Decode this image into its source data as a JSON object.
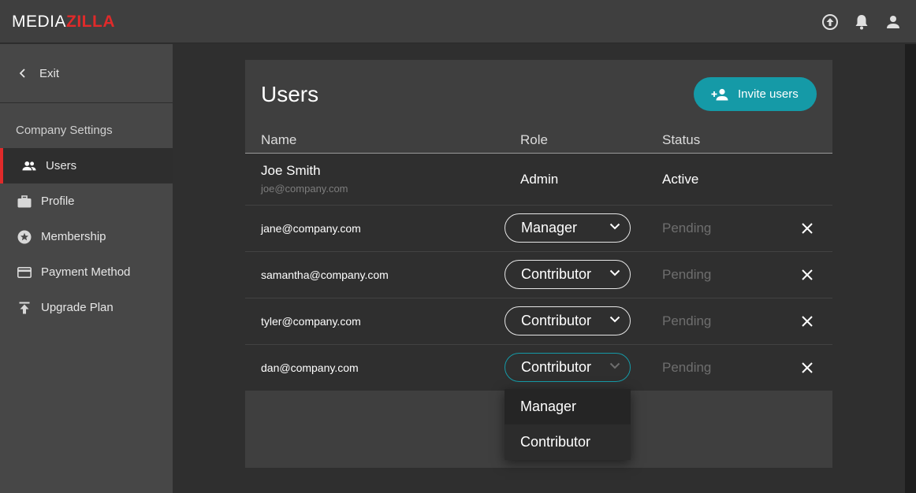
{
  "app": {
    "logo_part1": "MEDIA",
    "logo_part2": "ZILLA",
    "brand_red": "#e02a2a",
    "accent": "#159aa7"
  },
  "topbar": {
    "icons": [
      "upload-icon",
      "bell-icon",
      "account-icon"
    ]
  },
  "sidebar": {
    "exit_label": "Exit",
    "section_title": "Company Settings",
    "items": [
      {
        "label": "Users",
        "icon": "users-icon",
        "active": true
      },
      {
        "label": "Profile",
        "icon": "briefcase-icon"
      },
      {
        "label": "Membership",
        "icon": "star-badge-icon"
      },
      {
        "label": "Payment Method",
        "icon": "credit-card-icon"
      },
      {
        "label": "Upgrade Plan",
        "icon": "upgrade-icon"
      }
    ]
  },
  "users": {
    "title": "Users",
    "invite_label": "Invite users",
    "columns": {
      "name": "Name",
      "role": "Role",
      "status": "Status"
    },
    "owner": {
      "name": "Joe Smith",
      "email": "joe@company.com",
      "role": "Admin",
      "status": "Active"
    },
    "invites": [
      {
        "email": "jane@company.com",
        "role": "Manager",
        "status": "Pending"
      },
      {
        "email": "samantha@company.com",
        "role": "Contributor",
        "status": "Pending"
      },
      {
        "email": "tyler@company.com",
        "role": "Contributor",
        "status": "Pending"
      },
      {
        "email": "dan@company.com",
        "role": "Contributor",
        "status": "Pending"
      }
    ]
  },
  "role_menu": {
    "options": [
      "Manager",
      "Contributor"
    ]
  }
}
